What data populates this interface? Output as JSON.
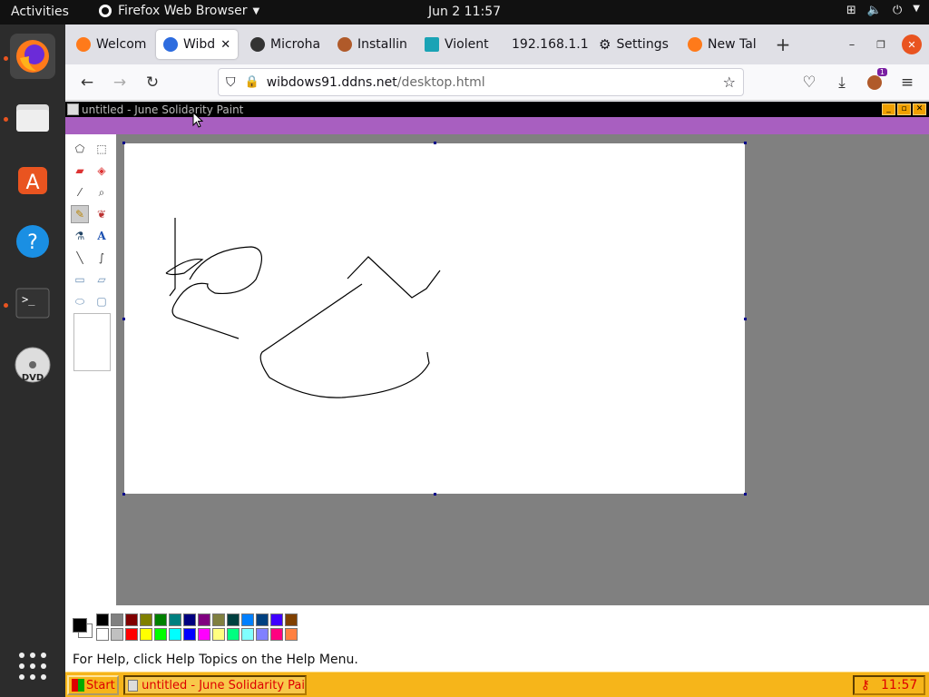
{
  "topbar": {
    "activities": "Activities",
    "app_name": "Firefox Web Browser",
    "clock": "Jun 2  11:57"
  },
  "dock": {
    "items": [
      "firefox-icon",
      "files-icon",
      "app-store-icon",
      "help-icon",
      "terminal-icon",
      "dvd-icon",
      "app-grid-icon"
    ]
  },
  "browser": {
    "tabs": [
      {
        "label": "Welcom",
        "icon": "firefox-icon"
      },
      {
        "label": "Wibd",
        "icon": "globe-icon",
        "active": true
      },
      {
        "label": "Microha",
        "icon": "pen-icon"
      },
      {
        "label": "Installin",
        "icon": "monkey-icon"
      },
      {
        "label": "Violent",
        "icon": "puzzle-icon"
      },
      {
        "label": "192.168.1.1",
        "icon": ""
      },
      {
        "label": "Settings",
        "icon": "gear-icon"
      },
      {
        "label": "New Tal",
        "icon": "firefox-icon"
      }
    ],
    "url_host": "wibdows91.ddns.net",
    "url_path": "/desktop.html",
    "extension_badge": "1"
  },
  "paint": {
    "title": "untitled - June Solidarity Paint",
    "status": "For Help, click Help Topics on the Help Menu.",
    "tools": [
      "free-select-icon",
      "rect-select-icon",
      "eraser-icon",
      "fill-icon",
      "picker-icon",
      "magnifier-icon",
      "pencil-icon",
      "brush-icon",
      "airbrush-icon",
      "text-icon",
      "line-icon",
      "curve-icon",
      "rectangle-icon",
      "polygon-icon",
      "ellipse-icon",
      "rounded-rect-icon"
    ],
    "primary_color": "#000000",
    "secondary_color": "#ffffff",
    "palette": [
      "#000000",
      "#808080",
      "#800000",
      "#808000",
      "#008000",
      "#008080",
      "#000080",
      "#800080",
      "#808040",
      "#004040",
      "#0080ff",
      "#004080",
      "#4000ff",
      "#804000",
      "#ffffff",
      "#c0c0c0",
      "#ff0000",
      "#ffff00",
      "#00ff00",
      "#00ffff",
      "#0000ff",
      "#ff00ff",
      "#ffff80",
      "#00ff80",
      "#80ffff",
      "#8080ff",
      "#ff0080",
      "#ff8040"
    ]
  },
  "w98": {
    "start": "Start",
    "task": "untitled - June Solidarity Pai",
    "tray_time": "11:57"
  }
}
